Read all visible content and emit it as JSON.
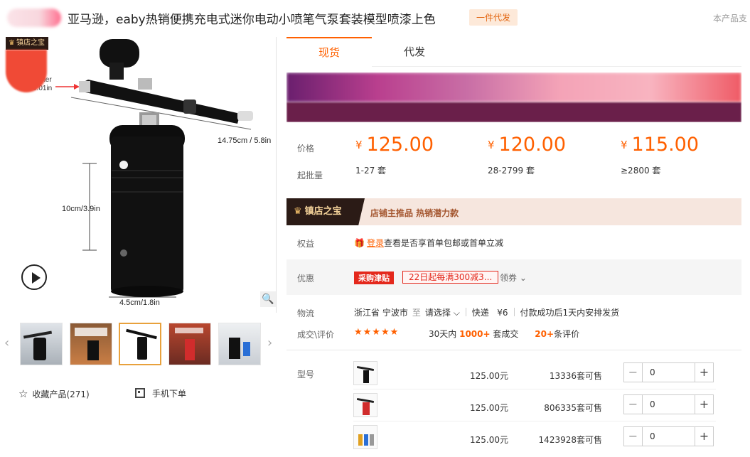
{
  "header": {
    "title": "亚马逊，eaby热销便携充电式迷你电动小喷笔气泵套装模型喷漆上色",
    "dropship_tag": "一件代发",
    "product_note": "本产品支"
  },
  "gallery": {
    "badge_text": "镇店之宝",
    "dim_length": "14.75cm / 5.8in",
    "dim_height": "10cm/3.9in",
    "dim_base": "4.5cm/1.8in",
    "dim_nozzle_partial": "ter",
    "dim_nozzle_value": "0.01in",
    "thumbnails": [
      "thumb-1",
      "thumb-2",
      "thumb-3",
      "thumb-4",
      "thumb-5"
    ],
    "active_thumbnail": 3
  },
  "actions": {
    "favorite_label": "收藏产品(271)",
    "mobile_order_label": "手机下单"
  },
  "tabs": [
    {
      "label": "现货",
      "active": true
    },
    {
      "label": "代发",
      "active": false
    }
  ],
  "pricing": {
    "price_label": "价格",
    "moq_label": "起批量",
    "currency": "¥",
    "tiers": [
      {
        "price": "125.00",
        "range": "1-27 套"
      },
      {
        "price": "120.00",
        "range": "28-2799 套"
      },
      {
        "price": "115.00",
        "range": "≥2800 套"
      }
    ]
  },
  "treasure": {
    "badge": "镇店之宝",
    "text": "店铺主推品  热销潜力款"
  },
  "rights": {
    "label": "权益",
    "login_link": "登录",
    "text": "查看是否享首单包邮或首单立减"
  },
  "promotion": {
    "label": "优惠",
    "tag": "采购津贴",
    "detail": "22日起每满300减3...",
    "receive": "领券",
    "receive_arrow": "⌄"
  },
  "logistics": {
    "label": "物流",
    "origin": "浙江省 宁波市",
    "to": "至",
    "destination": "请选择",
    "express": "快递",
    "fee": "¥6",
    "dispatch": "付款成功后1天内安排发货"
  },
  "deals": {
    "label": "成交\\评价",
    "stars": "★★★★★",
    "prefix": "30天内",
    "count": "1000+",
    "count_suffix": "套成交",
    "reviews": "20+",
    "reviews_suffix": "条评价"
  },
  "sku": {
    "label": "型号",
    "items": [
      {
        "price": "125.00元",
        "stock": "13336套可售",
        "qty": "0"
      },
      {
        "price": "125.00元",
        "stock": "806335套可售",
        "qty": "0"
      },
      {
        "price": "125.00元",
        "stock": "1423928套可售",
        "qty": "0"
      }
    ]
  },
  "colors": {
    "accent": "#ff6000",
    "coupon_red": "#e4281c"
  }
}
